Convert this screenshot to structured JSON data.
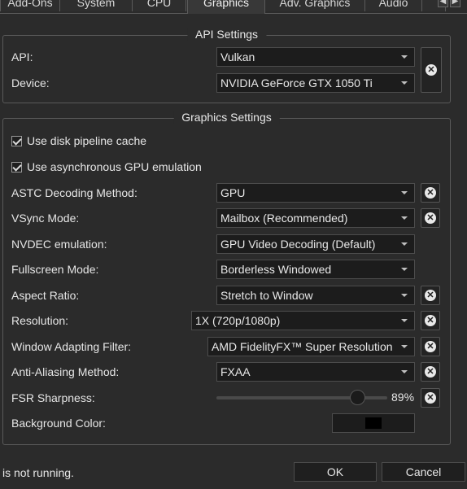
{
  "tabs": [
    {
      "label": "Add-Ons"
    },
    {
      "label": "System"
    },
    {
      "label": "CPU"
    },
    {
      "label": "Graphics"
    },
    {
      "label": "Adv. Graphics"
    },
    {
      "label": "Audio"
    }
  ],
  "api_settings": {
    "title": "API Settings",
    "api_label": "API:",
    "api_value": "Vulkan",
    "device_label": "Device:",
    "device_value": "NVIDIA GeForce GTX 1050 Ti"
  },
  "graphics_settings": {
    "title": "Graphics Settings",
    "disk_pipeline_cache": "Use disk pipeline cache",
    "async_gpu": "Use asynchronous GPU emulation",
    "rows": {
      "astc": {
        "label": "ASTC Decoding Method:",
        "value": "GPU"
      },
      "vsync": {
        "label": "VSync Mode:",
        "value": "Mailbox (Recommended)"
      },
      "nvdec": {
        "label": "NVDEC emulation:",
        "value": "GPU Video Decoding (Default)"
      },
      "fullscreen": {
        "label": "Fullscreen Mode:",
        "value": "Borderless Windowed"
      },
      "aspect": {
        "label": "Aspect Ratio:",
        "value": "Stretch to Window"
      },
      "resolution": {
        "label": "Resolution:",
        "value": "1X (720p/1080p)"
      },
      "filter": {
        "label": "Window Adapting Filter:",
        "value": "AMD FidelityFX™ Super Resolution"
      },
      "aa": {
        "label": "Anti-Aliasing Method:",
        "value": "FXAA"
      },
      "fsr": {
        "label": "FSR Sharpness:",
        "value_text": "89%",
        "value": 0.89
      },
      "bg": {
        "label": "Background Color:",
        "color": "#000000"
      }
    }
  },
  "footer": {
    "status": "is not running.",
    "ok_label": "OK",
    "cancel_label": "Cancel"
  }
}
